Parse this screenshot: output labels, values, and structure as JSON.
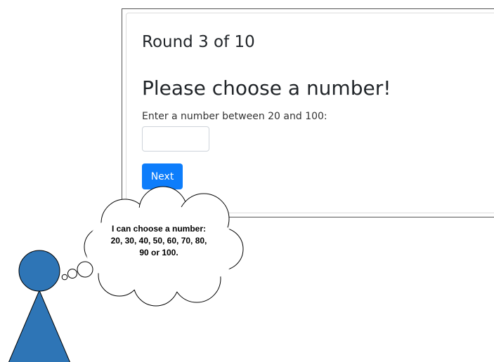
{
  "game": {
    "round_label": "Round 3 of 10",
    "heading": "Please choose a number!",
    "prompt": "Enter a number between 20 and 100:",
    "number_input": {
      "value": "",
      "placeholder": ""
    },
    "next_label": "Next"
  },
  "thought_bubble": {
    "text": "I can choose a number: 20, 30, 40, 50, 60, 70, 80, 90 or 100."
  },
  "colors": {
    "primary_button": "#0d7dfb",
    "figure_fill": "#2e75b6",
    "figure_stroke": "#000000"
  }
}
